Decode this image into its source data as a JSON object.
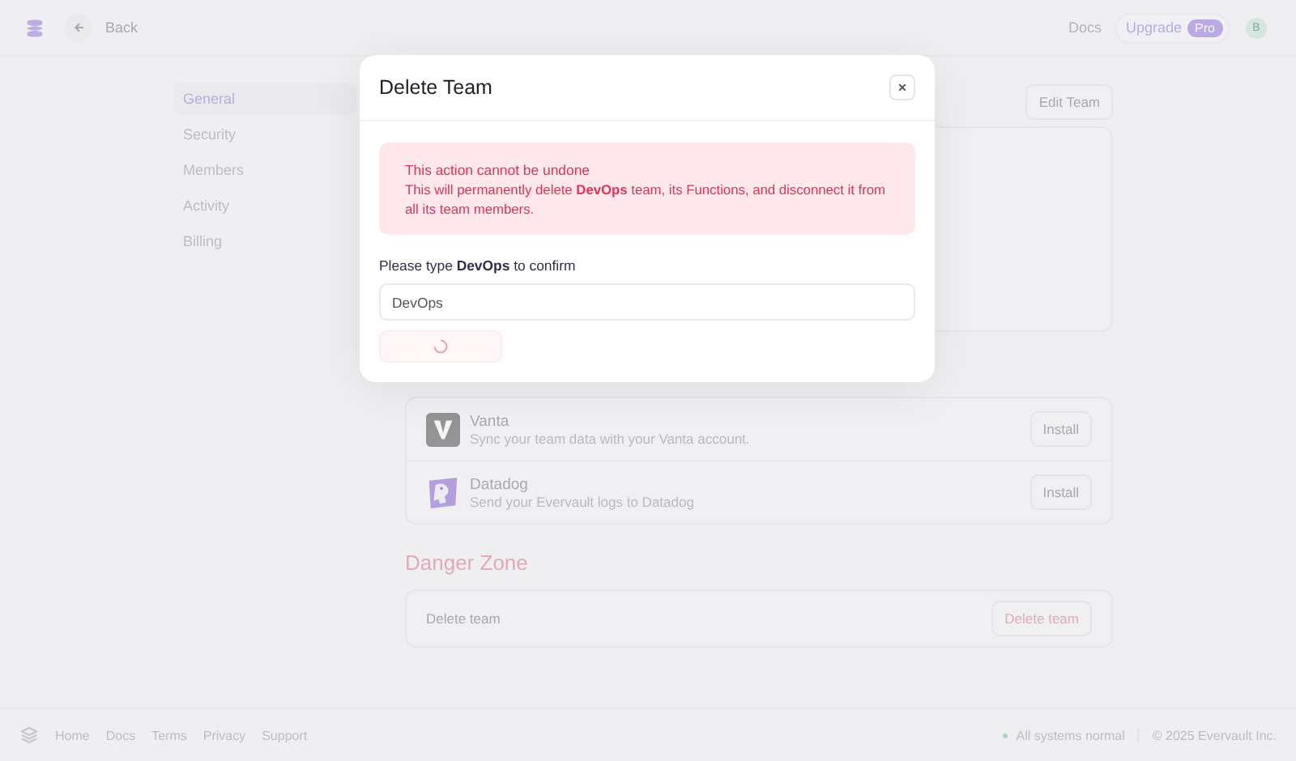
{
  "header": {
    "back_label": "Back",
    "docs_link": "Docs",
    "upgrade_label": "Upgrade",
    "plan_badge": "Pro",
    "avatar_initial": "B"
  },
  "sidebar": {
    "items": [
      {
        "label": "General",
        "selected": true
      },
      {
        "label": "Security",
        "selected": false
      },
      {
        "label": "Members",
        "selected": false
      },
      {
        "label": "Activity",
        "selected": false
      },
      {
        "label": "Billing",
        "selected": false
      }
    ]
  },
  "edit_button": "Edit Team",
  "integrations": [
    {
      "kind": "vanta",
      "name": "Vanta",
      "description": "Sync your team data with your Vanta account.",
      "action": "Install"
    },
    {
      "kind": "datadog",
      "name": "Datadog",
      "description": "Send your Evervault logs to Datadog",
      "action": "Install"
    }
  ],
  "danger_zone": {
    "title": "Danger Zone",
    "row_label": "Delete team",
    "button": "Delete team"
  },
  "footer": {
    "links": [
      "Home",
      "Docs",
      "Terms",
      "Privacy",
      "Support"
    ],
    "status": "All systems normal",
    "copyright": "© 2025 Evervault Inc."
  },
  "modal": {
    "title": "Delete Team",
    "alert_title": "This action cannot be undone",
    "alert_body": "This will permanently delete **DevOps** team, its Functions, and disconnect it from all its team members.",
    "confirm_label": "Please type **DevOps** to confirm",
    "input_value": "DevOps",
    "submit_loading": true
  }
}
